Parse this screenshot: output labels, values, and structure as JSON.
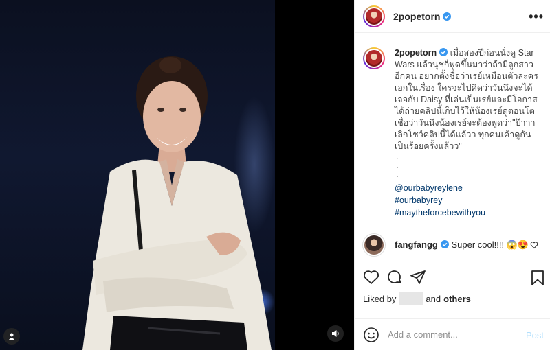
{
  "post": {
    "username": "2popetorn",
    "more_label": "•••"
  },
  "caption": {
    "username": "2popetorn",
    "text": "เมื่อสองปีก่อนนั่งดู Star Wars แล้วนุชก็พูดขึ้นมาว่าถ้ามีลูกสาวอีกคน อยากตั้งชื่อว่าเรย์เหมือนตัวละครเอกในเรื่อง ใครจะไปคิดว่าวันนึงจะได้เจอกับ Daisy ที่เล่นเป็นเรย์และมีโอกาสได้ถ่ายคลิปนี้เก็บไว้ให้น้องเรย์ดูตอนโต เชื่อว่าวันนึงน้องเรย์จะต้องพูดว่า\"ป๊าาา เลิกโชว์คลิปนี้ได้แล้วว ทุกคนเค้าดูกันเป็นร้อยครั้งแล้วว\"",
    "dots": [
      ".",
      ".",
      "."
    ],
    "tags": [
      "@ourbabyreylene",
      "#ourbabyrey",
      "#maytheforcebewithyou"
    ]
  },
  "comments": [
    {
      "username": "fangfangg",
      "text": "Super cool!!!! 😱😍"
    }
  ],
  "likes": {
    "prefix": "Liked by",
    "and": "and",
    "others": "others"
  },
  "comment_box": {
    "placeholder": "Add a comment...",
    "post_label": "Post"
  },
  "colors": {
    "verified": "#3897f0",
    "link": "#00376b",
    "post_disabled": "#b2dffc"
  }
}
